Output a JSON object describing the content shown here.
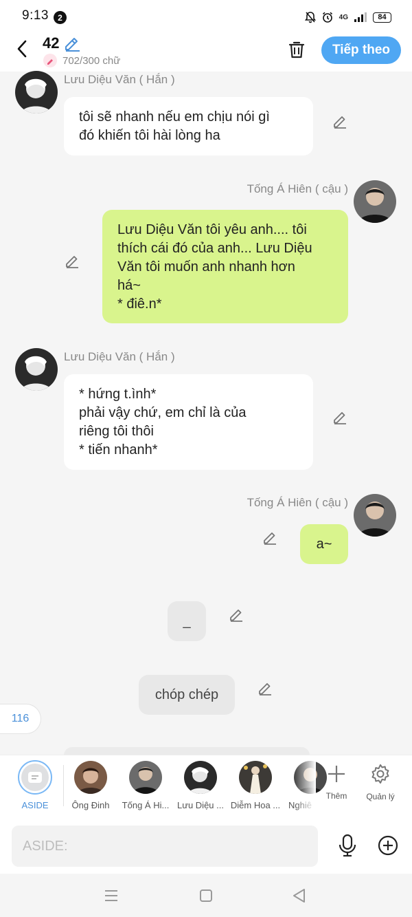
{
  "status_bar": {
    "time": "9:13",
    "notification_count": "2",
    "network": "4G",
    "battery": "84"
  },
  "header": {
    "chapter_number": "42",
    "word_count": "702/300 chữ",
    "next_label": "Tiếp theo"
  },
  "messages": [
    {
      "id": "m1",
      "side": "left",
      "speaker": "Lưu Diệu Văn ( Hắn )",
      "text": "tôi sẽ nhanh nếu em chịu nói gì\nđó khiến tôi hài lòng ha"
    },
    {
      "id": "m2",
      "side": "right",
      "speaker": "Tống Á Hiên ( cậu )",
      "text": "Lưu Diệu Văn tôi yêu anh.... tôi\nthích cái đó của anh... Lưu Diệu\nVăn tôi muốn anh nhanh hơn\nhá~\n* điê.n*"
    },
    {
      "id": "m3",
      "side": "left",
      "speaker": "Lưu Diệu Văn ( Hắn )",
      "text": "* hứng t.ình*\nphải vậy chứ, em chỉ là của\nriêng tôi thôi\n* tiến nhanh*"
    },
    {
      "id": "m4",
      "side": "right",
      "speaker": "Tống Á Hiên ( cậu )",
      "text": "a~"
    },
    {
      "id": "m5",
      "side": "center",
      "text": "_"
    },
    {
      "id": "m6",
      "side": "center",
      "text": "chóp chép"
    }
  ],
  "side_counter": "116",
  "characters": [
    {
      "label": "ASIDE",
      "selected": true
    },
    {
      "label": "Ông Đinh",
      "selected": false
    },
    {
      "label": "Tống Á Hi...",
      "selected": false
    },
    {
      "label": "Lưu Diệu ...",
      "selected": false
    },
    {
      "label": "Diễm Hoa ...",
      "selected": false
    },
    {
      "label": "Nghiê",
      "selected": false
    }
  ],
  "toolbar": {
    "more_label": "Thêm",
    "manage_label": "Quản lý"
  },
  "input": {
    "placeholder": "ASIDE:"
  },
  "colors": {
    "accent": "#4fa7f3",
    "right_bubble": "#d9f48d",
    "left_bubble": "#ffffff",
    "background": "#f5f5f5"
  },
  "icons": [
    "back-arrow-icon",
    "pencil-icon",
    "trash-icon",
    "microphone-icon",
    "plus-circle-icon",
    "gear-icon",
    "plus-icon",
    "menu-icon",
    "home-icon",
    "back-triangle-icon"
  ]
}
